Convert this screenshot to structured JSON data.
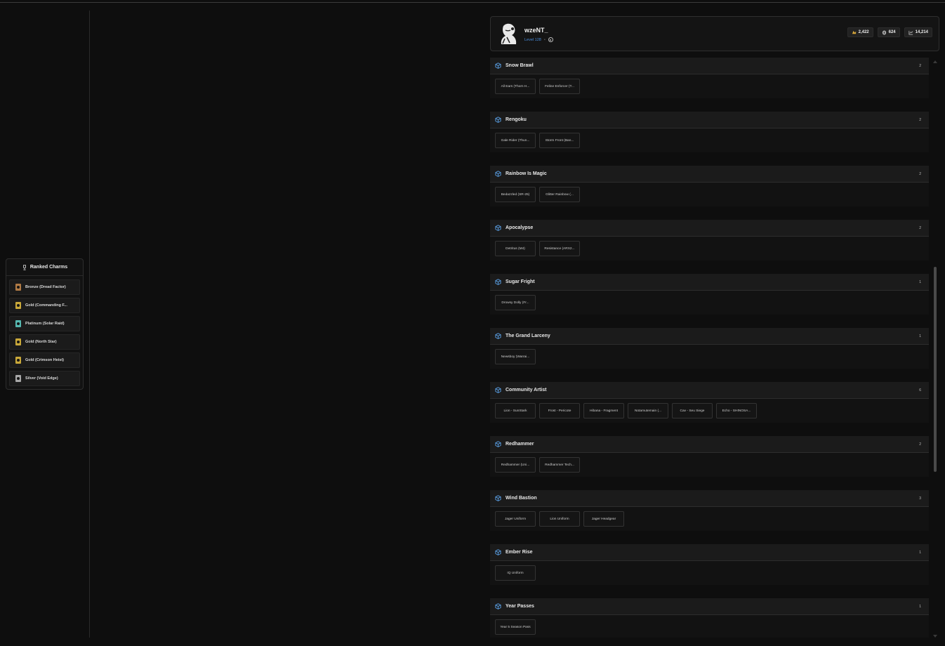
{
  "profile": {
    "username": "wzeNT_",
    "level": "Level 128",
    "stats": [
      {
        "icon": "coin-icon",
        "value": "2,422"
      },
      {
        "icon": "renown-icon",
        "value": "624"
      },
      {
        "icon": "chart-icon",
        "value": "14,214"
      }
    ]
  },
  "ranked_charms": {
    "title": "Ranked Charms",
    "items": [
      {
        "label": "Bronze (Dread Factor)",
        "color": "#b07a45"
      },
      {
        "label": "Gold (Commanding F...",
        "color": "#c9a83a"
      },
      {
        "label": "Platinum (Solar Raid)",
        "color": "#56b8b0"
      },
      {
        "label": "Gold (North Star)",
        "color": "#c9a83a"
      },
      {
        "label": "Gold (Crimson Heist)",
        "color": "#c9a83a"
      },
      {
        "label": "Silver (Void Edge)",
        "color": "#a8a8a8"
      }
    ]
  },
  "collections": [
    {
      "title": "Snow Brawl",
      "count": "2",
      "items": [
        "All Ears (Thorn H...",
        "Feline Enforcer (T..."
      ]
    },
    {
      "title": "Rengoku",
      "count": "2",
      "items": [
        "Gale Rider (Thun...",
        "Storm Front (Ban..."
      ]
    },
    {
      "title": "Rainbow Is Magic",
      "count": "2",
      "items": [
        "Bedazzled (SR-25)",
        "Glitter Rainbow (..."
      ]
    },
    {
      "title": "Apocalypse",
      "count": "2",
      "items": [
        "Detritus (M4)",
        "Resistance (ARX2..."
      ]
    },
    {
      "title": "Sugar Fright",
      "count": "1",
      "items": [
        "Drowsy Dolly (Fr..."
      ]
    },
    {
      "title": "The Grand Larceny",
      "count": "1",
      "items": [
        "Newsboy (Warrai..."
      ]
    },
    {
      "title": "Community Artist",
      "count": "6",
      "items": [
        "Lion - SunStark",
        "Frost - Pericote",
        "Hibana - Fragment",
        "Notamutemain (...",
        "Cav - Seu Siege",
        "Echo - SHINOSA..."
      ]
    },
    {
      "title": "Redhammer",
      "count": "2",
      "items": [
        "Redhammer (Uni...",
        "Redhammer Tech..."
      ]
    },
    {
      "title": "Wind Bastion",
      "count": "3",
      "items": [
        "Jager Uniform",
        "Lion Uniform",
        "Jager Headgear"
      ]
    },
    {
      "title": "Ember Rise",
      "count": "1",
      "items": [
        "IQ Uniform"
      ]
    },
    {
      "title": "Year Passes",
      "count": "1",
      "items": [
        "Year 5 Season Pass"
      ]
    }
  ],
  "colors": {
    "accent_blue": "#4a8fe0",
    "collection_icon": "#5aa0e6"
  }
}
